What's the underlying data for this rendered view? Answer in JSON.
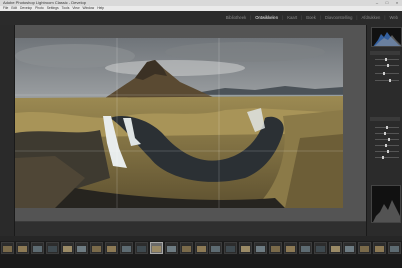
{
  "window": {
    "title": "Adobe Photoshop Lightroom Classic - Develop",
    "minimize_glyph": "–",
    "maximize_glyph": "□",
    "close_glyph": "×"
  },
  "menu": {
    "items": [
      "File",
      "Edit",
      "Develop",
      "Photo",
      "Settings",
      "Tools",
      "View",
      "Window",
      "Help"
    ]
  },
  "modules": {
    "items": [
      "Bibliotheek",
      "Ontwikkelen",
      "Kaart",
      "Boek",
      "Diavoorstelling",
      "Afdrukken",
      "Web"
    ],
    "active_index": 1
  },
  "filmstrip": {
    "thumbnail_count": 27,
    "selected_index": 10,
    "thumb_palette": [
      "#7a6a4a",
      "#8d7a55",
      "#5d6b72",
      "#3f4a50",
      "#9a8a66",
      "#6e7c83"
    ]
  },
  "colors": {
    "panel_bg": "#2b2b2b",
    "workarea_bg": "#545454",
    "filmstrip_bg": "#1c1c1c"
  }
}
